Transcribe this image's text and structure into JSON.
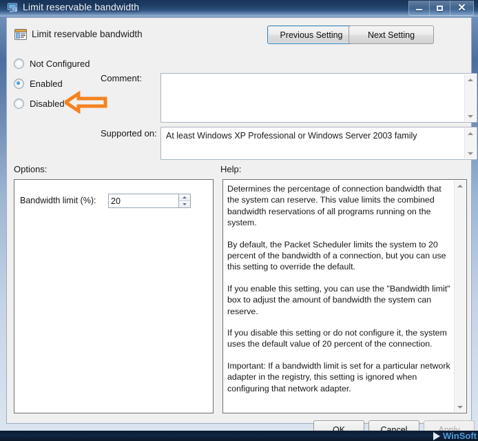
{
  "window": {
    "title": "Limit reservable bandwidth",
    "icon": "policy-monitor-icon",
    "controls": {
      "minimize": "minimize-icon",
      "maximize": "maximize-icon",
      "close": "close-icon"
    }
  },
  "header": {
    "icon": "policy-setting-icon",
    "title": "Limit reservable bandwidth",
    "previous_setting_label": "Previous Setting",
    "next_setting_label": "Next Setting"
  },
  "state": {
    "options": [
      {
        "label": "Not Configured",
        "selected": false
      },
      {
        "label": "Enabled",
        "selected": true
      },
      {
        "label": "Disabled",
        "selected": false
      }
    ],
    "selected": "Enabled"
  },
  "annotation": {
    "type": "left-arrow",
    "color": "#F5821F",
    "points_at": "Enabled"
  },
  "comment": {
    "label": "Comment:",
    "value": "",
    "placeholder": ""
  },
  "supported_on": {
    "label": "Supported on:",
    "value": "At least Windows XP Professional or Windows Server 2003 family"
  },
  "options_panel": {
    "label": "Options:",
    "bandwidth_limit_label": "Bandwidth limit (%):",
    "bandwidth_limit_value": "20"
  },
  "help_panel": {
    "label": "Help:",
    "paragraphs": [
      "Determines the percentage of connection bandwidth that the system can reserve. This value limits the combined bandwidth reservations of all programs running on the system.",
      "By default, the Packet Scheduler limits the system to 20 percent of the bandwidth of a connection, but you can use this setting to override the default.",
      "If you enable this setting, you can use the \"Bandwidth limit\" box to adjust the amount of bandwidth the system can reserve.",
      "If you disable this setting or do not configure it, the system uses the default value of 20 percent of the connection.",
      "Important: If a bandwidth limit is set for a particular network adapter in the registry, this setting is ignored when configuring that network adapter."
    ]
  },
  "footer": {
    "ok_label": "OK",
    "cancel_label": "Cancel",
    "apply_label": "Apply",
    "apply_enabled": false
  },
  "watermark": {
    "text": "WinSoft"
  }
}
